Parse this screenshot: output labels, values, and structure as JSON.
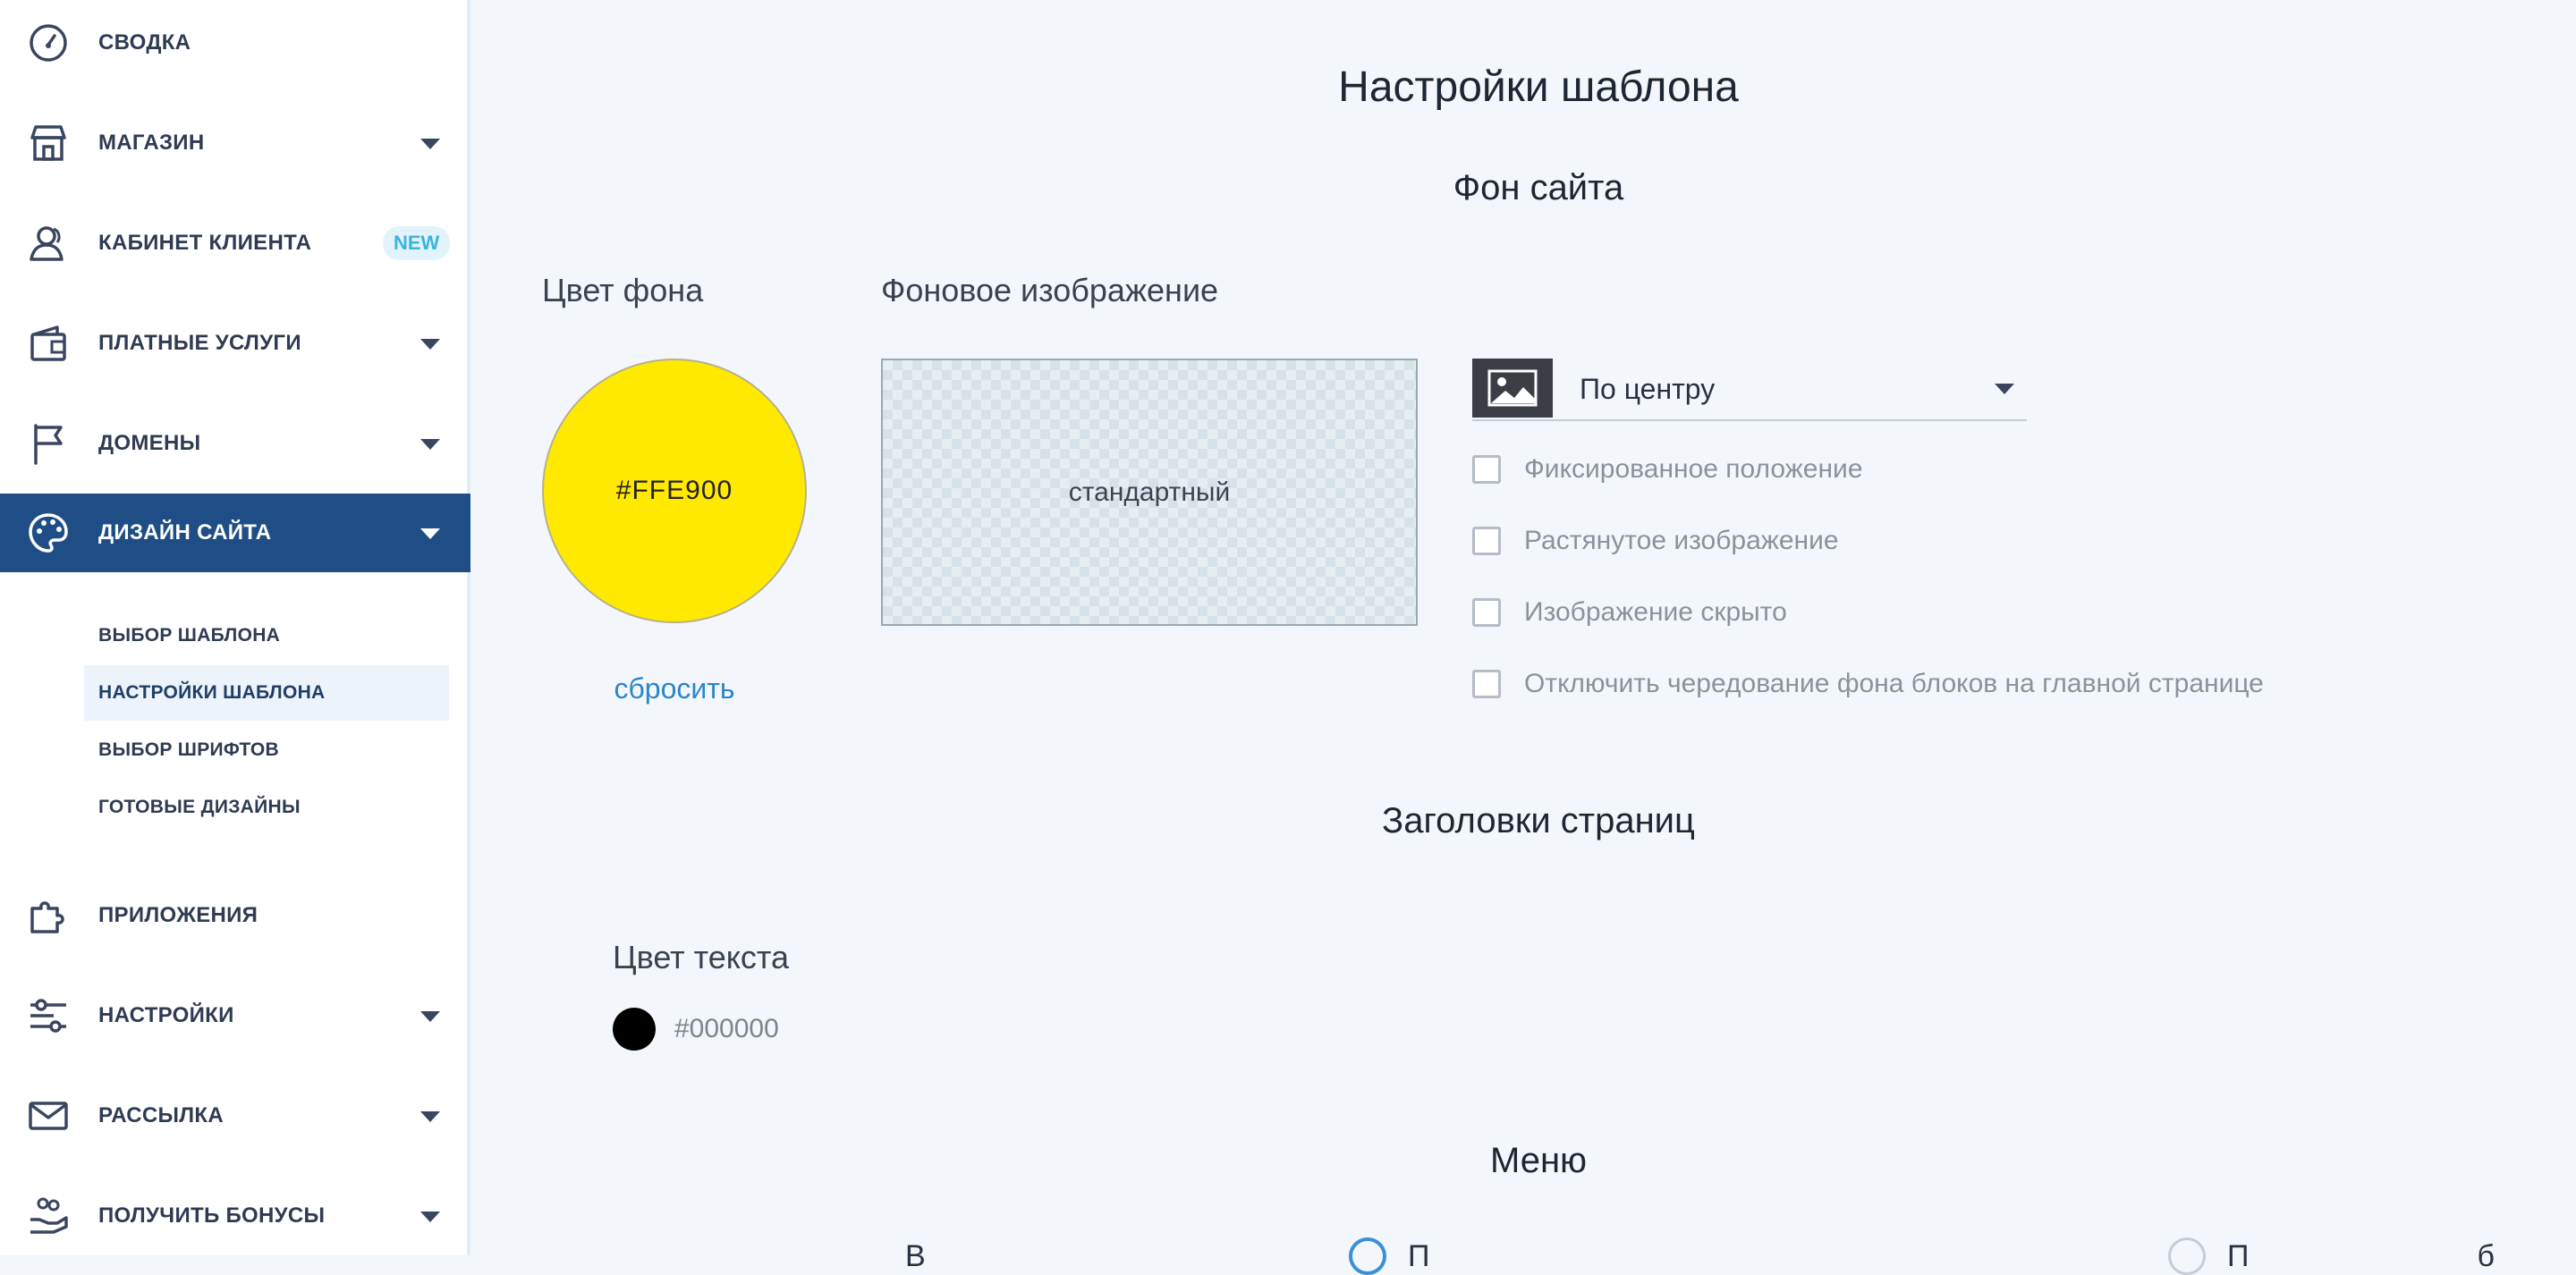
{
  "sidebar": {
    "items": [
      {
        "label": "СВОДКА",
        "icon": "dashboard-gauge-icon"
      },
      {
        "label": "МАГАЗИН",
        "icon": "store-icon"
      },
      {
        "label": "КАБИНЕТ КЛИЕНТА",
        "icon": "user-account-icon",
        "badge": "NEW"
      },
      {
        "label": "ПЛАТНЫЕ УСЛУГИ",
        "icon": "wallet-icon"
      },
      {
        "label": "ДОМЕНЫ",
        "icon": "flag-icon"
      },
      {
        "label": "ДИЗАЙН САЙТА",
        "icon": "palette-icon"
      },
      {
        "label": "ПРИЛОЖЕНИЯ",
        "icon": "puzzle-icon"
      },
      {
        "label": "НАСТРОЙКИ",
        "icon": "sliders-icon"
      },
      {
        "label": "РАССЫЛКА",
        "icon": "envelope-icon"
      },
      {
        "label": "ПОЛУЧИТЬ БОНУСЫ",
        "icon": "gift-hand-icon"
      }
    ],
    "design_subitems": [
      {
        "label": "ВЫБОР ШАБЛОНА"
      },
      {
        "label": "НАСТРОЙКИ ШАБЛОНА"
      },
      {
        "label": "ВЫБОР ШРИФТОВ"
      },
      {
        "label": "ГОТОВЫЕ ДИЗАЙНЫ"
      }
    ],
    "active_item": "ДИЗАЙН САЙТА",
    "active_subitem": "НАСТРОЙКИ ШАБЛОНА"
  },
  "main": {
    "title": "Настройки шаблона",
    "background_section": {
      "title": "Фон сайта",
      "color_label": "Цвет фона",
      "color_value": "#FFE900",
      "reset_link": "сбросить",
      "image_label": "Фоновое изображение",
      "image_placeholder": "стандартный",
      "position_select": {
        "value": "По центру",
        "icon": "image-icon"
      },
      "checkboxes": [
        {
          "label": "Фиксированное положение",
          "checked": false
        },
        {
          "label": "Растянутое изображение",
          "checked": false
        },
        {
          "label": "Изображение скрыто",
          "checked": false
        },
        {
          "label": "Отключить чередование фона блоков на главной странице",
          "checked": false
        }
      ]
    },
    "headings_section": {
      "title": "Заголовки страниц",
      "text_color_label": "Цвет текста",
      "text_color_value": "#000000"
    },
    "menu_section": {
      "title": "Меню",
      "partial_label_1": "В",
      "partial_label_2": "П",
      "partial_label_3": "П                           б"
    }
  },
  "colors": {
    "sidebar_active": "#1f4e86",
    "link": "#2b86c9",
    "badge_text": "#3bb4e0",
    "background": "#f3f7fc"
  }
}
